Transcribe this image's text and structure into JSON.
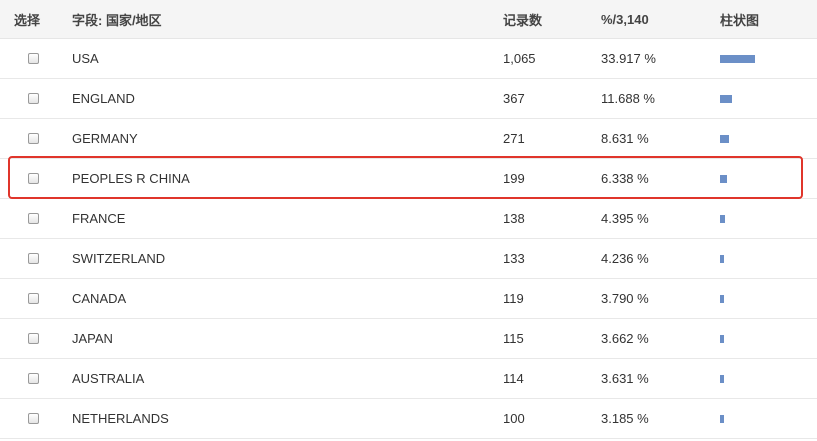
{
  "header": {
    "select": "选择",
    "field": "字段: 国家/地区",
    "count": "记录数",
    "percent": "%/3,140",
    "chart": "柱状图"
  },
  "accent_colors": {
    "bar": "#6b8fc7",
    "highlight": "#e0352b"
  },
  "highlighted_row": "PEOPLES R CHINA",
  "rows": [
    {
      "country": "USA",
      "count": "1,065",
      "percent": "33.917 %",
      "share": 0.33917,
      "checked": false
    },
    {
      "country": "ENGLAND",
      "count": "367",
      "percent": "11.688 %",
      "share": 0.11688,
      "checked": false
    },
    {
      "country": "GERMANY",
      "count": "271",
      "percent": "8.631 %",
      "share": 0.08631,
      "checked": false
    },
    {
      "country": "PEOPLES R CHINA",
      "count": "199",
      "percent": "6.338 %",
      "share": 0.06338,
      "checked": false
    },
    {
      "country": "FRANCE",
      "count": "138",
      "percent": "4.395 %",
      "share": 0.04395,
      "checked": false
    },
    {
      "country": "SWITZERLAND",
      "count": "133",
      "percent": "4.236 %",
      "share": 0.04236,
      "checked": false
    },
    {
      "country": "CANADA",
      "count": "119",
      "percent": "3.790 %",
      "share": 0.0379,
      "checked": false
    },
    {
      "country": "JAPAN",
      "count": "115",
      "percent": "3.662 %",
      "share": 0.03662,
      "checked": false
    },
    {
      "country": "AUSTRALIA",
      "count": "114",
      "percent": "3.631 %",
      "share": 0.03631,
      "checked": false
    },
    {
      "country": "NETHERLANDS",
      "count": "100",
      "percent": "3.185 %",
      "share": 0.03185,
      "checked": false
    }
  ]
}
